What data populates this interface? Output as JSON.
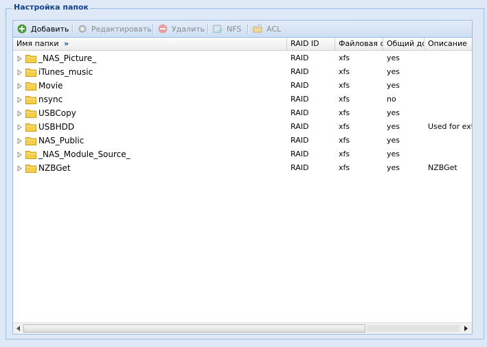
{
  "legend": "Настройка папок",
  "toolbar": {
    "add": "Добавить",
    "edit": "Редактировать",
    "delete": "Удалить",
    "nfs": "NFS",
    "acl": "ACL"
  },
  "columns": {
    "name": "Имя папки",
    "raid_id": "RAID ID",
    "fs": "Файловая си",
    "share": "Общий дос",
    "desc": "Описание"
  },
  "rows": [
    {
      "name": "_NAS_Picture_",
      "raid": "RAID",
      "fs": "xfs",
      "share": "yes",
      "desc": ""
    },
    {
      "name": "iTunes_music",
      "raid": "RAID",
      "fs": "xfs",
      "share": "yes",
      "desc": ""
    },
    {
      "name": "Movie",
      "raid": "RAID",
      "fs": "xfs",
      "share": "yes",
      "desc": ""
    },
    {
      "name": "nsync",
      "raid": "RAID",
      "fs": "xfs",
      "share": "no",
      "desc": ""
    },
    {
      "name": "USBCopy",
      "raid": "RAID",
      "fs": "xfs",
      "share": "yes",
      "desc": ""
    },
    {
      "name": "USBHDD",
      "raid": "RAID",
      "fs": "xfs",
      "share": "yes",
      "desc": "Used for exte"
    },
    {
      "name": "NAS_Public",
      "raid": "RAID",
      "fs": "xfs",
      "share": "yes",
      "desc": ""
    },
    {
      "name": "_NAS_Module_Source_",
      "raid": "RAID",
      "fs": "xfs",
      "share": "yes",
      "desc": ""
    },
    {
      "name": "NZBGet",
      "raid": "RAID",
      "fs": "xfs",
      "share": "yes",
      "desc": "NZBGet"
    }
  ],
  "colors": {
    "background": "#dfe8f6",
    "border": "#99bbe8",
    "legend": "#15428b",
    "folder": "#f5cf4a"
  }
}
